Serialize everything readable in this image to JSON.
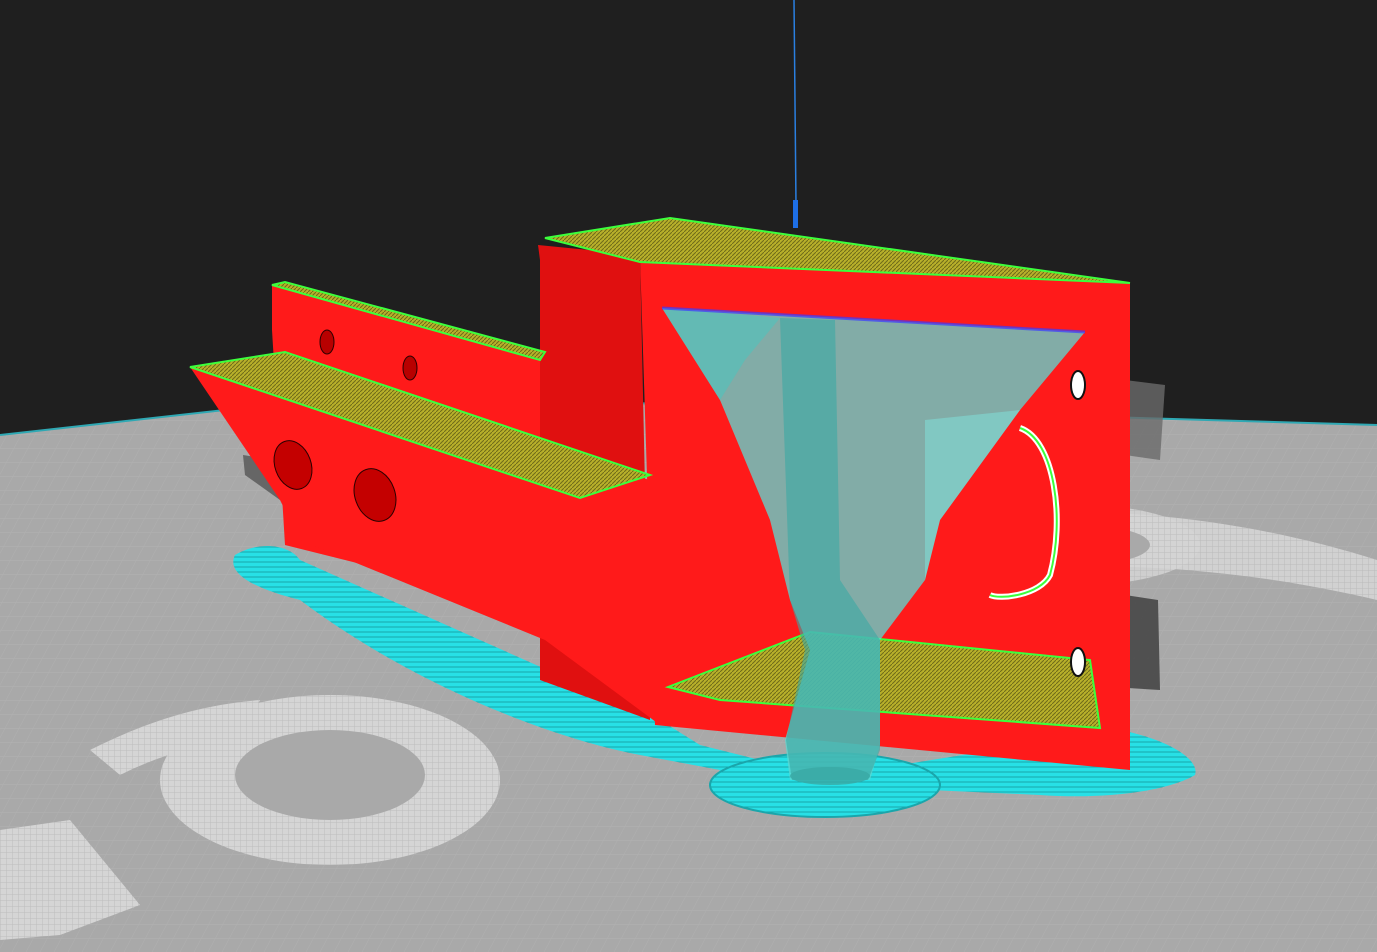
{
  "viewport": {
    "label": "",
    "colors": {
      "background": "#1f1f1f",
      "build_plate": "#a8a8a8",
      "build_plate_grid": "#b8b8b8",
      "build_plate_edge": "#2fa8b3",
      "plate_logo": "#d7d7d7",
      "wall_outer": "#ff1a1a",
      "wall_outer_shade": "#e01010",
      "top_skin": "#b8b02a",
      "skin_edge": "#3cff3c",
      "support": "#5fd6d0",
      "support_dark": "#3aa9a4",
      "skirt_brim": "#27e0e6",
      "travel_line": "#2a7fe0",
      "nozzle_marker": "#1e6fe6"
    }
  },
  "scene": {
    "model_icon": "printed-part-icon",
    "support_icon": "tree-support-icon",
    "brim_icon": "brim-icon",
    "nozzle_icon": "nozzle-marker-icon"
  }
}
